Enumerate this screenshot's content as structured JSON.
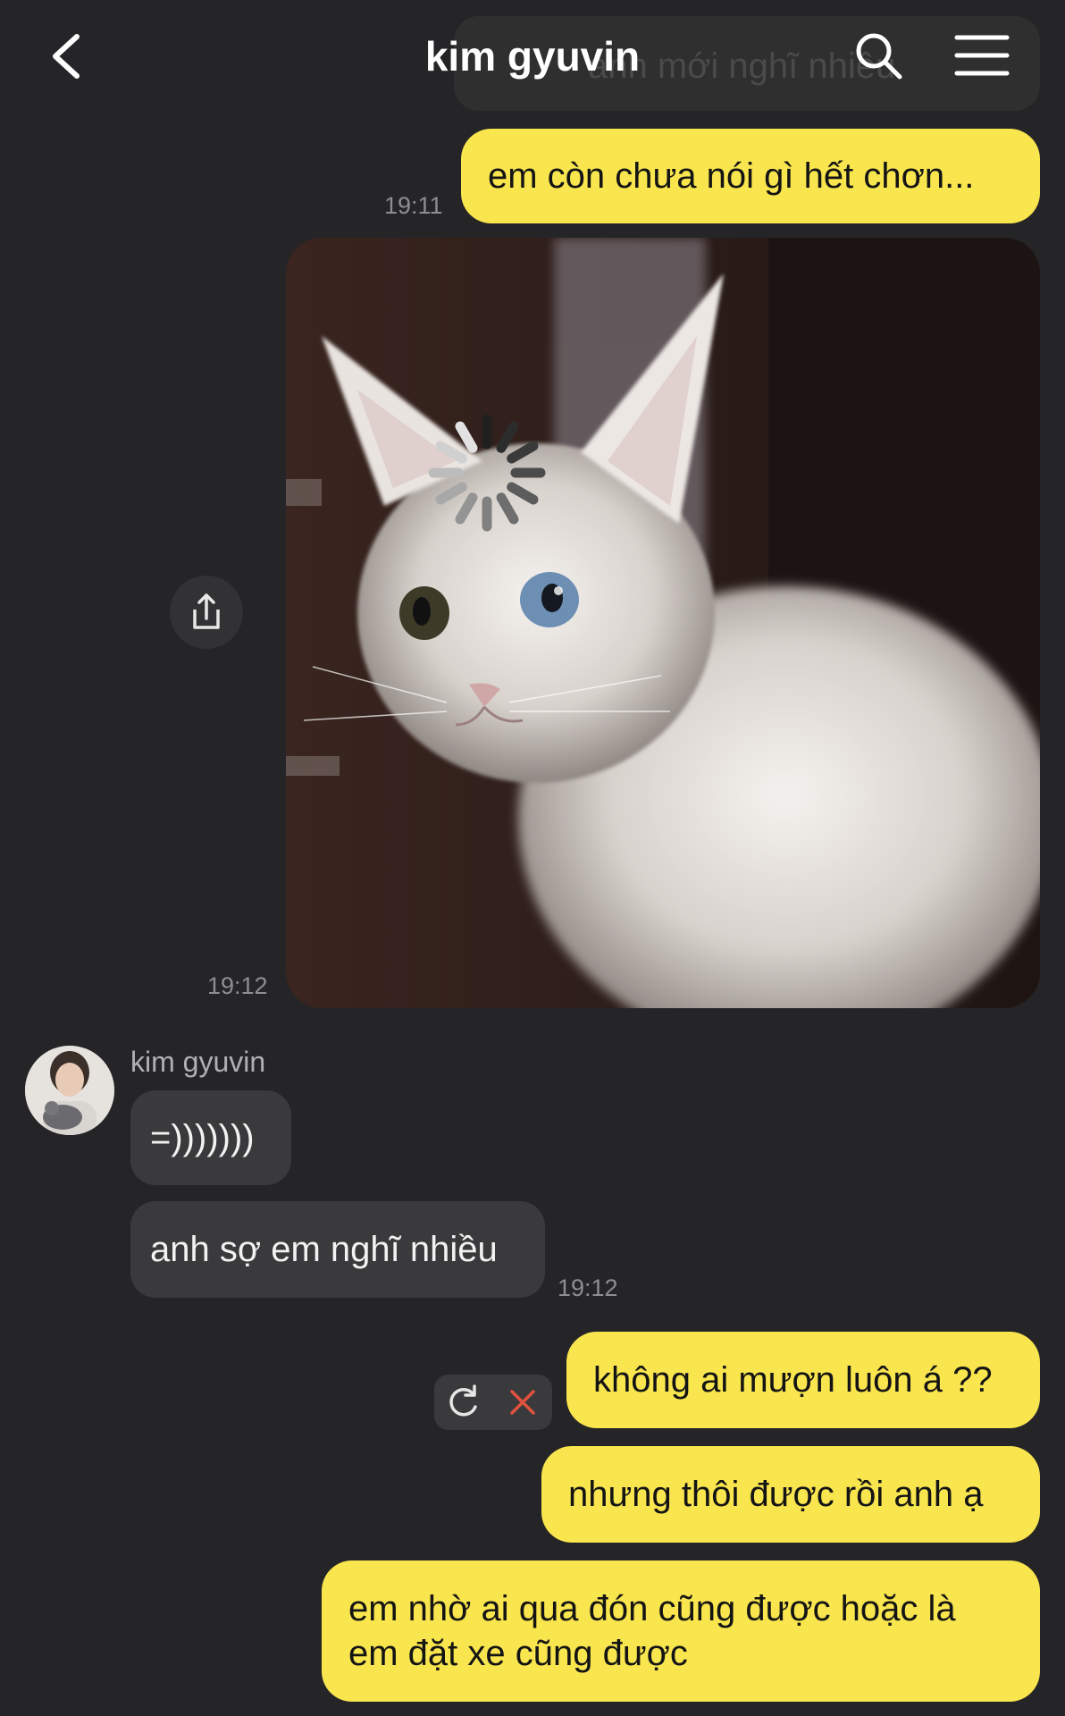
{
  "header": {
    "title": "kim gyuvin",
    "back_icon": "chevron-left-icon",
    "search_icon": "search-icon",
    "menu_icon": "menu-icon",
    "pinned_preview": "anh mới nghĩ nhiều"
  },
  "colors": {
    "background": "#252527",
    "my_bubble": "#f9e54e",
    "their_bubble": "#3a3a3c",
    "timestamp": "#8e8e92",
    "error_red": "#e0523d"
  },
  "messages": [
    {
      "from": "me",
      "text": "em còn chưa nói gì hết chơn...",
      "time": "19:11"
    },
    {
      "from": "me",
      "type": "image",
      "image": "white-kitten-with-loading-spinner",
      "time": "19:12"
    },
    {
      "from": "them",
      "sender": "kim gyuvin",
      "text": "=)))))))"
    },
    {
      "from": "them",
      "text": "anh sợ em nghĩ nhiều",
      "time": "19:12"
    },
    {
      "from": "me",
      "text": "không ai mượn luôn á ??",
      "status": "failed"
    },
    {
      "from": "me",
      "text": "nhưng thôi được rồi anh ạ"
    },
    {
      "from": "me",
      "text_line1": "em nhờ ai qua đón cũng được hoặc là",
      "text_line2": "em đặt xe cũng được"
    }
  ],
  "actions": {
    "share_icon": "share-icon",
    "retry_icon": "refresh-icon",
    "delete_icon": "close-icon"
  }
}
